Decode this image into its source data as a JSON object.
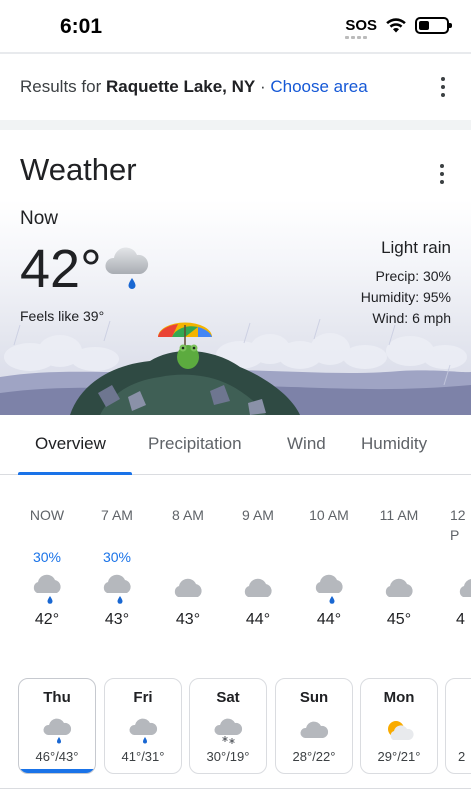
{
  "status_bar": {
    "time": "6:01",
    "sos": "SOS"
  },
  "results": {
    "prefix": "Results for ",
    "location": "Raquette Lake, NY",
    "separator": " · ",
    "choose_area": "Choose area"
  },
  "weather": {
    "title": "Weather",
    "now_label": "Now",
    "temperature": "42°",
    "feels_like": "Feels like 39°",
    "condition": "Light rain",
    "precip": "Precip: 30%",
    "humidity": "Humidity: 95%",
    "wind": "Wind: 6 mph"
  },
  "tabs": [
    "Overview",
    "Precipitation",
    "Wind",
    "Humidity"
  ],
  "hourly": [
    {
      "label": "NOW",
      "precip": "30%",
      "icon": "rain-cloud-icon",
      "temp": "42°"
    },
    {
      "label": "7 AM",
      "precip": "30%",
      "icon": "rain-cloud-icon",
      "temp": "43°"
    },
    {
      "label": "8 AM",
      "precip": "",
      "icon": "cloud-icon",
      "temp": "43°"
    },
    {
      "label": "9 AM",
      "precip": "",
      "icon": "cloud-icon",
      "temp": "44°"
    },
    {
      "label": "10 AM",
      "precip": "",
      "icon": "rain-cloud-icon",
      "temp": "44°"
    },
    {
      "label": "11 AM",
      "precip": "",
      "icon": "cloud-icon",
      "temp": "45°"
    },
    {
      "label": "12 P",
      "precip": "",
      "icon": "cloud-icon",
      "temp": "4"
    }
  ],
  "daily": [
    {
      "day": "Thu",
      "icon": "rain-cloud-icon",
      "range": "46°/43°",
      "selected": true
    },
    {
      "day": "Fri",
      "icon": "rain-cloud-icon",
      "range": "41°/31°",
      "selected": false
    },
    {
      "day": "Sat",
      "icon": "snow-cloud-icon",
      "range": "30°/19°",
      "selected": false
    },
    {
      "day": "Sun",
      "icon": "cloud-icon",
      "range": "28°/22°",
      "selected": false
    },
    {
      "day": "Mon",
      "icon": "partly-sunny-icon",
      "range": "29°/21°",
      "selected": false
    },
    {
      "day": "",
      "icon": "",
      "range": "2",
      "selected": false
    }
  ],
  "colors": {
    "accent": "#1a73e8",
    "link": "#1558d6",
    "rain_drop": "#1967d2"
  }
}
